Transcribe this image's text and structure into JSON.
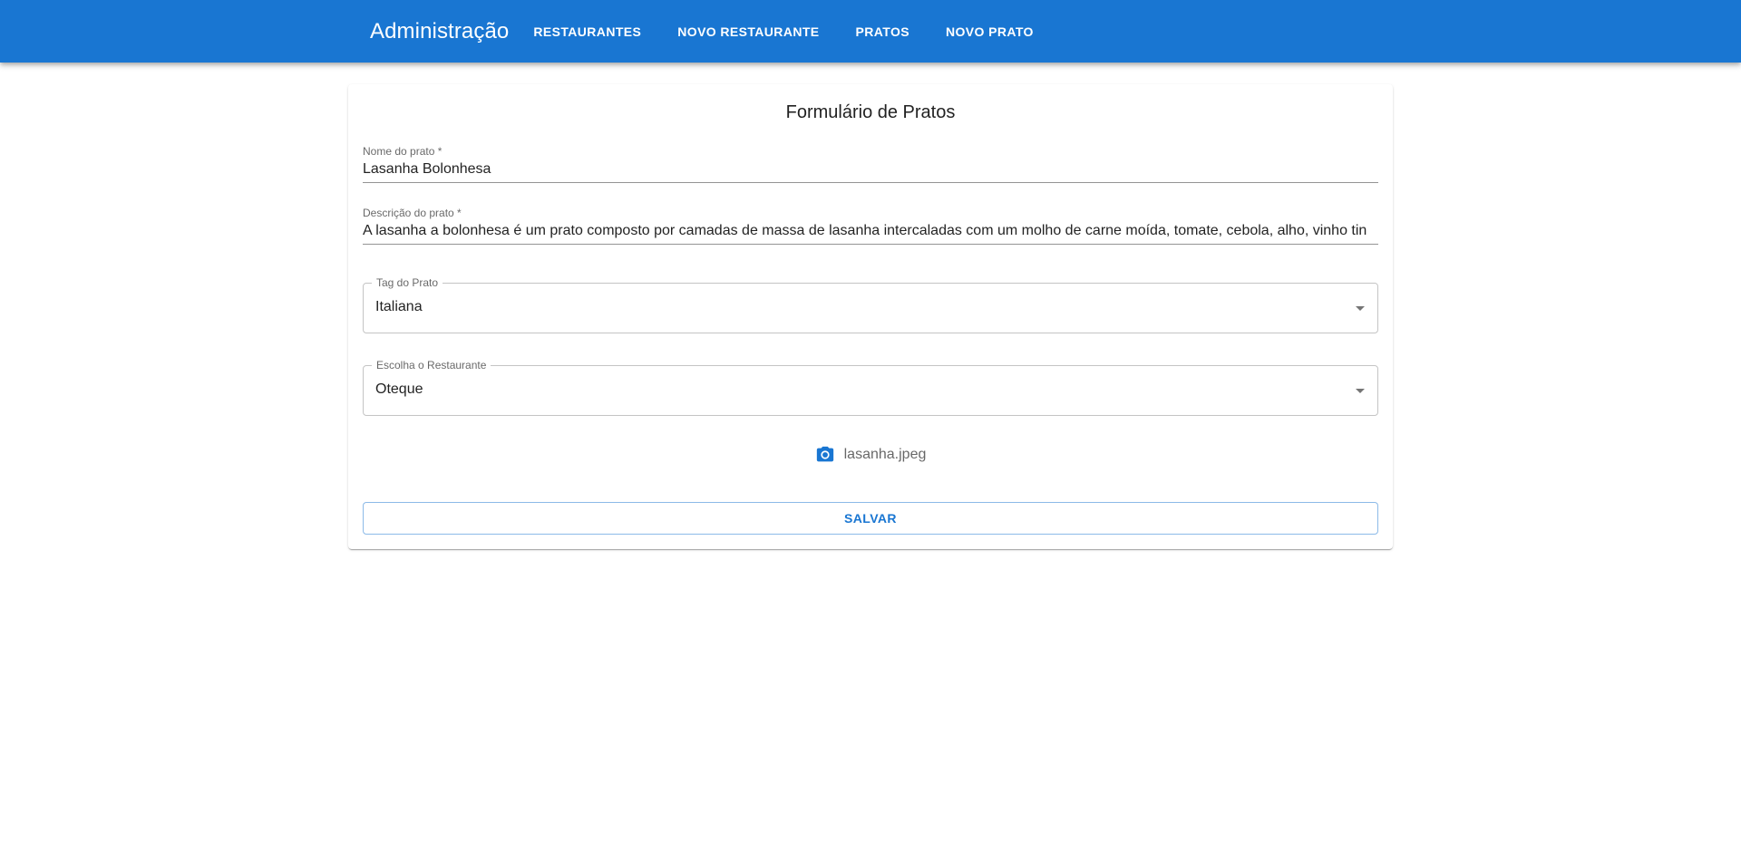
{
  "header": {
    "brand": "Administração",
    "nav": [
      {
        "label": "RESTAURANTES"
      },
      {
        "label": "NOVO RESTAURANTE"
      },
      {
        "label": "PRATOS"
      },
      {
        "label": "NOVO PRATO"
      }
    ],
    "background_color": "#1976d2"
  },
  "form": {
    "title": "Formulário de Pratos",
    "nome": {
      "label": "Nome do prato *",
      "value": "Lasanha Bolonhesa"
    },
    "descricao": {
      "label": "Descrição do prato *",
      "value": "A lasanha a bolonhesa é um prato composto por camadas de massa de lasanha intercaladas com um molho de carne moída, tomate, cebola, alho, vinho tin"
    },
    "tag": {
      "label": "Tag do Prato",
      "value": "Italiana"
    },
    "restaurante": {
      "label": "Escolha o Restaurante",
      "value": "Oteque"
    },
    "upload": {
      "icon": "camera-icon",
      "filename": "lasanha.jpeg"
    },
    "save_label": "SALVAR"
  }
}
